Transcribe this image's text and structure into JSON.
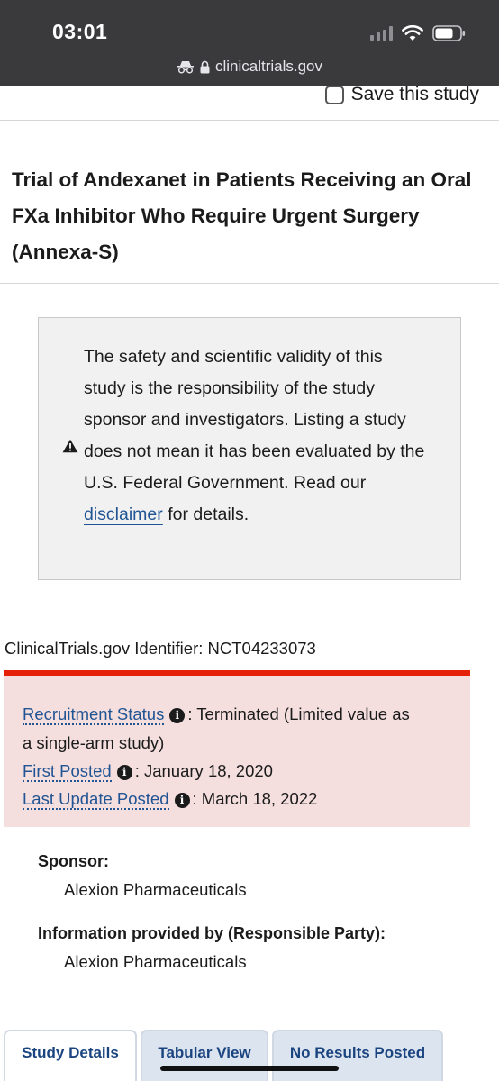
{
  "device": {
    "time": "03:01",
    "url": "clinicaltrials.gov",
    "icons": [
      "signal-icon",
      "wifi-icon",
      "battery-icon",
      "private-browsing-icon",
      "lock-icon"
    ]
  },
  "page": {
    "save_label": "Save this study",
    "title": "Trial of Andexanet in Patients Receiving an Oral FXa Inhibitor Who Require Urgent Surgery (Annexa-S)",
    "disclaimer": {
      "line1": "The safety and scientific validity of this study is the responsibility of the study sponsor and investigators.",
      "line2_before": "Listing a study does not mean it has been evaluated by the U.S. Federal Government. Read our",
      "link": "disclaimer",
      "line2_after": "for details."
    },
    "identifier": "ClinicalTrials.gov Identifier: NCT04233073",
    "status": {
      "recruitment_label": "Recruitment Status",
      "recruitment_value": ": Terminated (Limited value as",
      "recruitment_value_cont": "a single-arm study)",
      "first_posted_label": "First Posted",
      "first_posted_value": ": January 18, 2020",
      "last_update_label": "Last Update Posted",
      "last_update_value": ": March 18, 2022",
      "accent_color": "#e52207",
      "panel_color": "#f4dede"
    },
    "sponsor_label": "Sponsor:",
    "sponsor_value": "Alexion Pharmaceuticals",
    "responsible_label": "Information provided by (Responsible Party):",
    "responsible_value": "Alexion Pharmaceuticals",
    "tabs": [
      {
        "label": "Study Details",
        "active": true
      },
      {
        "label": "Tabular View",
        "active": false
      },
      {
        "label": "No Results Posted",
        "active": false
      }
    ]
  }
}
